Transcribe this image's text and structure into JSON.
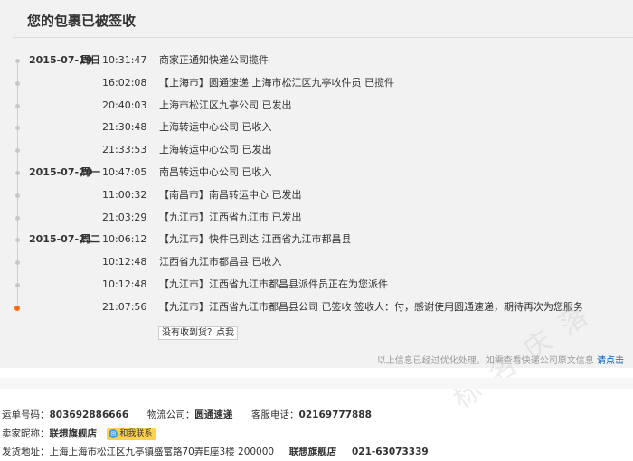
{
  "header": {
    "title": "您的包裹已被签收"
  },
  "tracking": [
    {
      "date": "2015-07-19",
      "weekday": "周日",
      "time": "10:31:47",
      "desc": "商家正通知快递公司揽件"
    },
    {
      "date": "",
      "weekday": "",
      "time": "16:02:08",
      "desc": "【上海市】圆通速递 上海市松江区九亭收件员 已揽件"
    },
    {
      "date": "",
      "weekday": "",
      "time": "20:40:03",
      "desc": "上海市松江区九亭公司 已发出"
    },
    {
      "date": "",
      "weekday": "",
      "time": "21:30:48",
      "desc": "上海转运中心公司 已收入"
    },
    {
      "date": "",
      "weekday": "",
      "time": "21:33:53",
      "desc": "上海转运中心公司 已发出"
    },
    {
      "date": "2015-07-20",
      "weekday": "周一",
      "time": "10:47:05",
      "desc": "南昌转运中心公司 已收入"
    },
    {
      "date": "",
      "weekday": "",
      "time": "11:00:32",
      "desc": "【南昌市】南昌转运中心 已发出"
    },
    {
      "date": "",
      "weekday": "",
      "time": "21:03:29",
      "desc": "【九江市】江西省九江市 已发出"
    },
    {
      "date": "2015-07-21",
      "weekday": "周二",
      "time": "10:06:12",
      "desc": "【九江市】快件已到达 江西省九江市都昌县"
    },
    {
      "date": "",
      "weekday": "",
      "time": "10:12:48",
      "desc": "江西省九江市都昌县 已收入"
    },
    {
      "date": "",
      "weekday": "",
      "time": "10:12:48",
      "desc": "【九江市】江西省九江市都昌县派件员正在为您派件"
    },
    {
      "date": "",
      "weekday": "",
      "time": "21:07:56",
      "desc": "【九江市】江西省九江市都昌县公司 已签收 签收人：付，感谢使用圆通速递，期待再次为您服务"
    }
  ],
  "actions": {
    "not_received": "没有收到货？点我"
  },
  "notice": {
    "text": "以上信息已经过优化处理，如需查看快递公司原文信息",
    "link": "请点击"
  },
  "watermark": "标 名 庆 落",
  "shipment": {
    "tracking_label": "运单号码：",
    "tracking_no": "803692886666",
    "carrier_label": "物流公司：",
    "carrier": "圆通速递",
    "phone_label": "客服电话：",
    "phone": "02169777888",
    "seller_label": "卖家昵称：",
    "seller": "联想旗舰店",
    "contact_label": "和我联系",
    "address_label": "发货地址：",
    "address": "上海上海市松江区九亭镇盛富路70弄E座3楼 200000",
    "address_seller": "联想旗舰店",
    "address_phone": "021-63073339"
  },
  "colors": {
    "accent_dot": "#ff6a13",
    "link": "#0a5fb4",
    "contact_badge": "#ffd24d"
  }
}
